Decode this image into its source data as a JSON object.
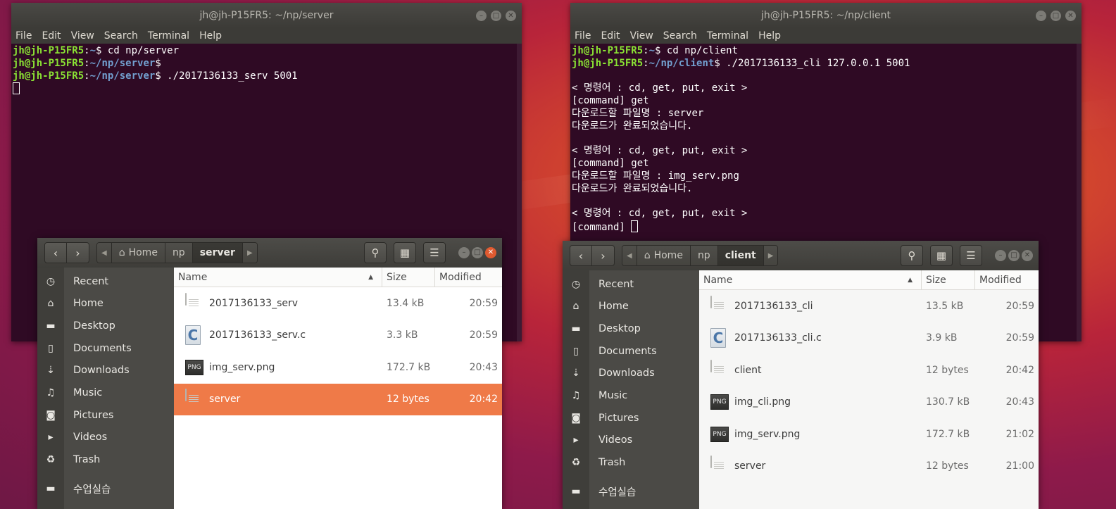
{
  "desktop": {
    "accent": "#e95420"
  },
  "term_left": {
    "title": "jh@jh-P15FR5: ~/np/server",
    "menu": [
      "File",
      "Edit",
      "View",
      "Search",
      "Terminal",
      "Help"
    ],
    "lines": [
      {
        "user": "jh@jh-P15FR5",
        "path": "~",
        "cmd": "$ cd np/server"
      },
      {
        "user": "jh@jh-P15FR5",
        "path": "~/np/server",
        "cmd": "$"
      },
      {
        "user": "jh@jh-P15FR5",
        "path": "~/np/server",
        "cmd": "$ ./2017136133_serv 5001"
      }
    ]
  },
  "term_right": {
    "title": "jh@jh-P15FR5: ~/np/client",
    "menu": [
      "File",
      "Edit",
      "View",
      "Search",
      "Terminal",
      "Help"
    ],
    "prompt_lines": [
      {
        "user": "jh@jh-P15FR5",
        "path": "~",
        "cmd": "$ cd np/client"
      },
      {
        "user": "jh@jh-P15FR5",
        "path": "~/np/client",
        "cmd": "$ ./2017136133_cli 127.0.0.1 5001"
      }
    ],
    "output": [
      "",
      "< 명령어 : cd, get, put, exit >",
      "[command] get",
      "다운로드할 파일명 : server",
      "다운로드가 완료되었습니다.",
      "",
      "< 명령어 : cd, get, put, exit >",
      "[command] get",
      "다운로드할 파일명 : img_serv.png",
      "다운로드가 완료되었습니다.",
      "",
      "< 명령어 : cd, get, put, exit >"
    ],
    "last_prompt": "[command] "
  },
  "fm_left": {
    "crumbs": [
      "Home",
      "np",
      "server"
    ],
    "columns": [
      "Name",
      "Size",
      "Modified"
    ],
    "sidebar": [
      "Recent",
      "Home",
      "Desktop",
      "Documents",
      "Downloads",
      "Music",
      "Pictures",
      "Videos",
      "Trash",
      "수업실습"
    ],
    "files": [
      {
        "name": "2017136133_serv",
        "size": "13.4 kB",
        "modified": "20:59",
        "icon": "document-icon"
      },
      {
        "name": "2017136133_serv.c",
        "size": "3.3 kB",
        "modified": "20:59",
        "icon": "c-source-icon"
      },
      {
        "name": "img_serv.png",
        "size": "172.7 kB",
        "modified": "20:43",
        "icon": "png-icon"
      },
      {
        "name": "server",
        "size": "12 bytes",
        "modified": "20:42",
        "icon": "document-icon"
      }
    ]
  },
  "fm_right": {
    "crumbs": [
      "Home",
      "np",
      "client"
    ],
    "columns": [
      "Name",
      "Size",
      "Modified"
    ],
    "sidebar": [
      "Recent",
      "Home",
      "Desktop",
      "Documents",
      "Downloads",
      "Music",
      "Pictures",
      "Videos",
      "Trash",
      "수업실습"
    ],
    "files": [
      {
        "name": "2017136133_cli",
        "size": "13.5 kB",
        "modified": "20:59",
        "icon": "document-icon"
      },
      {
        "name": "2017136133_cli.c",
        "size": "3.9 kB",
        "modified": "20:59",
        "icon": "c-source-icon"
      },
      {
        "name": "client",
        "size": "12 bytes",
        "modified": "20:42",
        "icon": "document-icon"
      },
      {
        "name": "img_cli.png",
        "size": "130.7 kB",
        "modified": "20:43",
        "icon": "png-icon"
      },
      {
        "name": "img_serv.png",
        "size": "172.7 kB",
        "modified": "21:02",
        "icon": "png-icon"
      },
      {
        "name": "server",
        "size": "12 bytes",
        "modified": "21:00",
        "icon": "document-icon"
      }
    ]
  },
  "icons": {
    "png_label": "PNG",
    "c_label": "C"
  }
}
